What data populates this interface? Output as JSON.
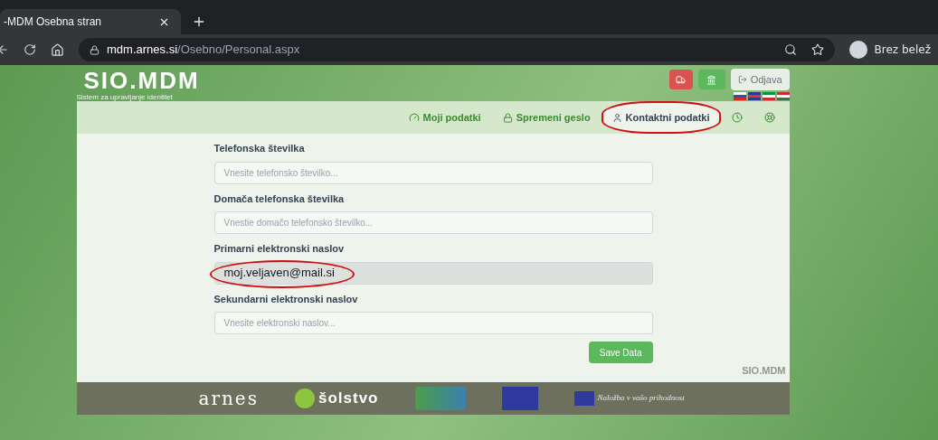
{
  "browser": {
    "tab_title": "-MDM Osebna stran",
    "url_host": "mdm.arnes.si",
    "url_path": "/Osebno/Personal.aspx",
    "profile": "Brez belež"
  },
  "header": {
    "logo": "SIO.MDM",
    "tagline": "Sistem za upravljanje identitet",
    "logout": "Odjava"
  },
  "nav": [
    {
      "label": "Moji podatki",
      "selected": false,
      "circled": false
    },
    {
      "label": "Spremeni geslo",
      "selected": false,
      "circled": false
    },
    {
      "label": "Kontaktni podatki",
      "selected": true,
      "circled": true
    }
  ],
  "fields": [
    {
      "label": "Telefonska številka",
      "placeholder": "Vnesite telefonsko številko...",
      "disabled": false,
      "circled": false
    },
    {
      "label": "Domača telefonska številka",
      "placeholder": "Vnestie domačo telefonsko številko...",
      "disabled": false,
      "circled": false
    },
    {
      "label": "Primarni elektronski naslov",
      "value": "moj.veljaven@mail.si",
      "disabled": true,
      "circled": true
    },
    {
      "label": "Sekundarni elektronski naslov",
      "placeholder": "Vnesite elektronski naslov...",
      "disabled": false,
      "circled": false
    }
  ],
  "save_button": "Save Data",
  "corner_mark": "SIO.MDM",
  "footer": {
    "arnes": "arnes",
    "solstvo": "šolstvo",
    "slogan": "Naložba v vašo prihodnost"
  }
}
